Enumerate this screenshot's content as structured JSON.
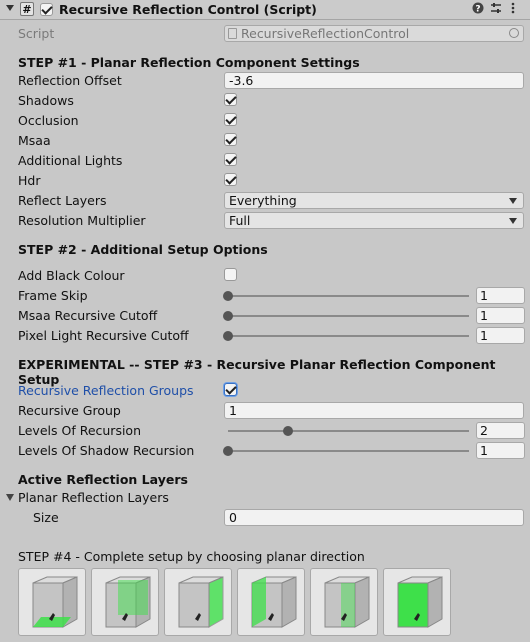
{
  "header": {
    "title": "Recursive Reflection Control (Script)",
    "script_icon": "#",
    "enabled": true,
    "help_icon": "help-icon",
    "preset_icon": "preset-icon",
    "menu_icon": "menu-icon"
  },
  "script_row": {
    "label": "Script",
    "value": "RecursiveReflectionControl"
  },
  "step1": {
    "title": "STEP #1 - Planar Reflection Component Settings",
    "reflection_offset_label": "Reflection Offset",
    "reflection_offset_value": "-3.6",
    "shadows_label": "Shadows",
    "shadows": true,
    "occlusion_label": "Occlusion",
    "occlusion": true,
    "msaa_label": "Msaa",
    "msaa": true,
    "additional_lights_label": "Additional Lights",
    "additional_lights": true,
    "hdr_label": "Hdr",
    "hdr": true,
    "reflect_layers_label": "Reflect Layers",
    "reflect_layers_value": "Everything",
    "resolution_label": "Resolution Multiplier",
    "resolution_value": "Full"
  },
  "step2": {
    "title": "STEP #2 - Additional Setup Options",
    "add_black_label": "Add Black Colour",
    "add_black": false,
    "frame_skip_label": "Frame Skip",
    "frame_skip_value": "1",
    "msaa_cutoff_label": "Msaa Recursive Cutoff",
    "msaa_cutoff_value": "1",
    "pixel_light_label": "Pixel Light Recursive Cutoff",
    "pixel_light_value": "1"
  },
  "step3": {
    "title": "EXPERIMENTAL -- STEP #3 - Recursive Planar Reflection Component Setup",
    "groups_label": "Recursive Reflection Groups",
    "groups": true,
    "group_label": "Recursive Group",
    "group_value": "1",
    "levels_label": "Levels Of Recursion",
    "levels_value": "2",
    "shadow_levels_label": "Levels Of Shadow Recursion",
    "shadow_levels_value": "1"
  },
  "layers": {
    "title": "Active Reflection Layers",
    "foldout_label": "Planar Reflection Layers",
    "size_label": "Size",
    "size_value": "0"
  },
  "step4": {
    "title": "STEP #4 - Complete setup by choosing planar direction",
    "buttons": [
      "floor",
      "back",
      "right",
      "left",
      "front",
      "right-solid"
    ]
  },
  "colors": {
    "accent_green": "#3ee04a",
    "checkbox_focus": "#3a72c4"
  }
}
